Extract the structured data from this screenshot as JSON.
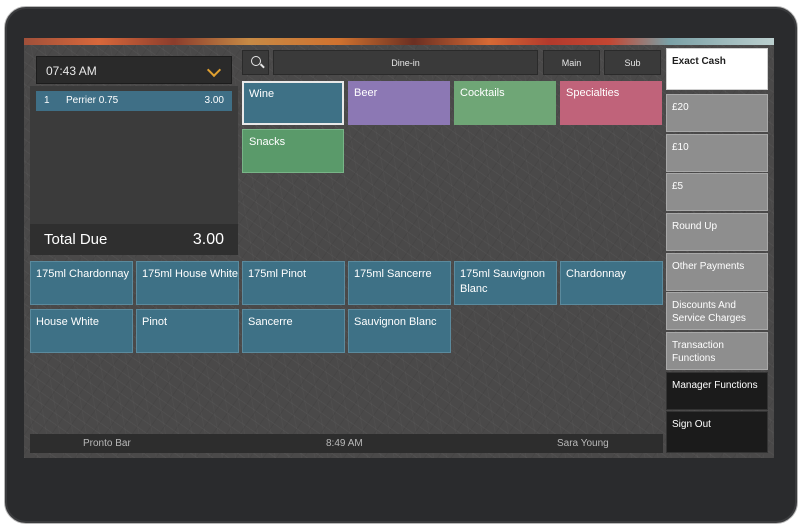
{
  "check": {
    "time": "07:43 AM",
    "lines": [
      {
        "qty": "1",
        "name": "Perrier 0.75",
        "price": "3.00"
      }
    ],
    "total_label": "Total Due",
    "total_value": "3.00"
  },
  "top_bar": {
    "order_type": "Dine-in",
    "main": "Main",
    "sub": "Sub"
  },
  "categories": [
    {
      "label": "Wine",
      "color": "#3e7186"
    },
    {
      "label": "Beer",
      "color": "#8c78b4"
    },
    {
      "label": "Cocktails",
      "color": "#6fa676"
    },
    {
      "label": "Specialties",
      "color": "#c0637a"
    },
    {
      "label": "Snacks",
      "color": "#5a9a6a"
    }
  ],
  "items": [
    {
      "label": "175ml Chardonnay"
    },
    {
      "label": "175ml House White"
    },
    {
      "label": "175ml Pinot"
    },
    {
      "label": "175ml Sancerre"
    },
    {
      "label": "175ml Sauvignon Blanc"
    },
    {
      "label": "Chardonnay"
    },
    {
      "label": "House White"
    },
    {
      "label": "Pinot"
    },
    {
      "label": "Sancerre"
    },
    {
      "label": "Sauvignon Blanc"
    }
  ],
  "payments": [
    {
      "label": "Exact Cash"
    },
    {
      "label": "£20"
    },
    {
      "label": "£10"
    },
    {
      "label": "£5"
    },
    {
      "label": "Round Up"
    },
    {
      "label": "Other Payments"
    },
    {
      "label": "Discounts And Service Charges"
    },
    {
      "label": "Transaction Functions"
    },
    {
      "label": "Manager Functions"
    },
    {
      "label": "Sign Out"
    }
  ],
  "footer": {
    "location": "Pronto Bar",
    "time": "8:49 AM",
    "user": "Sara Young"
  }
}
